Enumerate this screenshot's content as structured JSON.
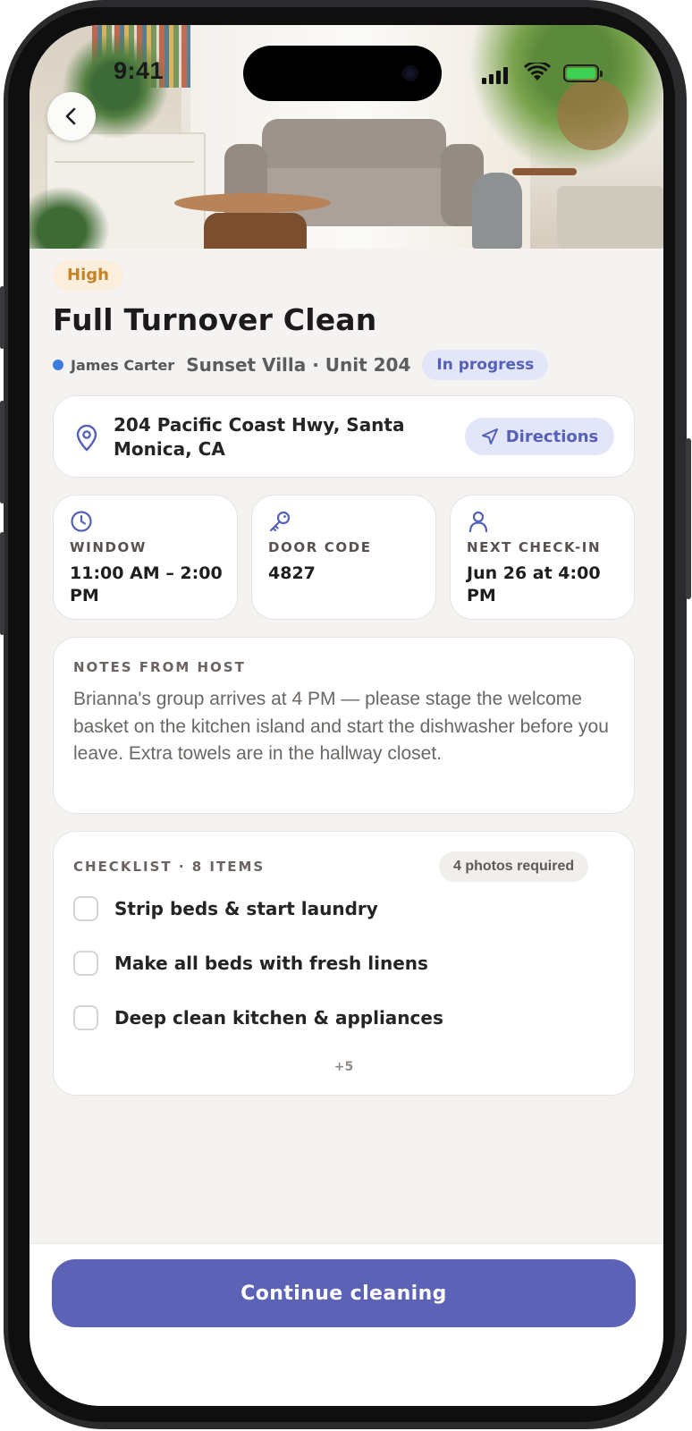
{
  "status_bar": {
    "time": "9:41"
  },
  "job": {
    "priority": "High",
    "title": "Full Turnover Clean",
    "host_name": "James Carter",
    "property": "Sunset Villa · Unit 204",
    "status": "In progress",
    "address": "204 Pacific Coast Hwy, Santa Monica, CA",
    "directions_label": "Directions"
  },
  "info": [
    {
      "icon": "clock-icon",
      "label": "WINDOW",
      "value": "11:00 AM – 2:00 PM"
    },
    {
      "icon": "key-icon",
      "label": "DOOR CODE",
      "value": "4827"
    },
    {
      "icon": "person-icon",
      "label": "NEXT CHECK-IN",
      "value": "Jun 26 at 4:00 PM"
    }
  ],
  "notes": {
    "label": "NOTES FROM HOST",
    "text": "Brianna's group arrives at 4 PM — please stage the welcome basket on the kitchen island and start the dishwasher before you leave. Extra towels are in the hallway closet."
  },
  "checklist": {
    "label": "CHECKLIST · 8 ITEMS",
    "photos_required": "4 photos required",
    "items": [
      {
        "label": "Strip beds & start laundry",
        "checked": false
      },
      {
        "label": "Make all beds with fresh linens",
        "checked": false
      },
      {
        "label": "Deep clean kitchen & appliances",
        "checked": false
      }
    ],
    "more": "+5"
  },
  "cta": {
    "label": "Continue cleaning"
  },
  "colors": {
    "accent": "#5c62b6",
    "status_bg": "#e3e6f8",
    "priority_text": "#c58326",
    "priority_bg": "#fbeedd",
    "background": "#f4f3f1",
    "host_dot": "#3c7be0"
  }
}
